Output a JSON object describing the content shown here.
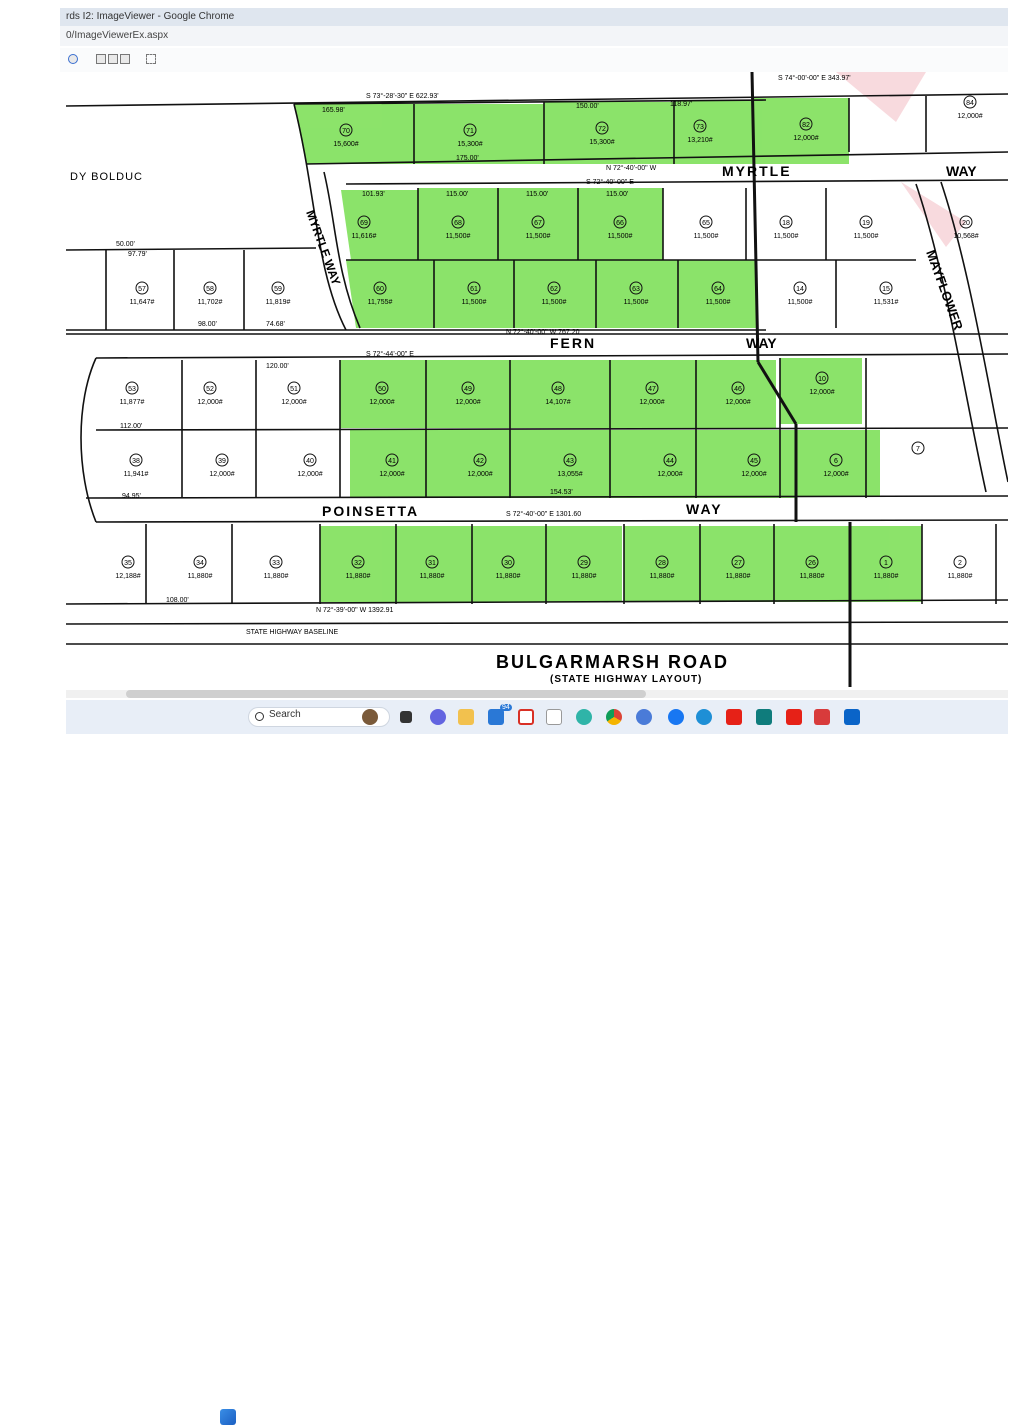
{
  "window": {
    "title": "rds I2: ImageViewer - Google Chrome",
    "address": "0/ImageViewerEx.aspx"
  },
  "map": {
    "neighbor_label": "DY  BOLDUC",
    "streets": [
      {
        "name": "MYRTLE"
      },
      {
        "name": "WAY"
      },
      {
        "name": "FERN"
      },
      {
        "name": "POINSETTA"
      },
      {
        "name": "WAY"
      },
      {
        "name": "WAY"
      },
      {
        "name": "BULGARMARSH   ROAD"
      },
      {
        "name": "(STATE  HIGHWAY  LAYOUT)"
      },
      {
        "name": "MAYFLOWER"
      },
      {
        "name": "MYRTLE  WAY"
      },
      {
        "name": "STATE HIGHWAY BASELINE"
      }
    ],
    "lots": [
      {
        "id": "70",
        "area": "15,600",
        "highlight": true
      },
      {
        "id": "71",
        "area": "15,300",
        "highlight": true
      },
      {
        "id": "72",
        "area": "15,300",
        "highlight": true
      },
      {
        "id": "73",
        "area": "13,210",
        "highlight": true
      },
      {
        "id": "82",
        "area": "12,000",
        "highlight": true
      },
      {
        "id": "84",
        "area": "12,000",
        "highlight": false
      },
      {
        "id": "69",
        "area": "11,616",
        "highlight": true
      },
      {
        "id": "68",
        "area": "11,500",
        "highlight": true
      },
      {
        "id": "67",
        "area": "11,500",
        "highlight": true
      },
      {
        "id": "66",
        "area": "11,500",
        "highlight": true
      },
      {
        "id": "65",
        "area": "11,500",
        "highlight": false
      },
      {
        "id": "18",
        "area": "11,500",
        "highlight": false
      },
      {
        "id": "19",
        "area": "11,500",
        "highlight": false
      },
      {
        "id": "20",
        "area": "10,568",
        "highlight": false
      },
      {
        "id": "60",
        "area": "11,755",
        "highlight": true
      },
      {
        "id": "61",
        "area": "11,500",
        "highlight": true
      },
      {
        "id": "62",
        "area": "11,500",
        "highlight": true
      },
      {
        "id": "63",
        "area": "11,500",
        "highlight": true
      },
      {
        "id": "64",
        "area": "11,500",
        "highlight": true
      },
      {
        "id": "14",
        "area": "11,500",
        "highlight": false
      },
      {
        "id": "15",
        "area": "11,531",
        "highlight": false
      },
      {
        "id": "57",
        "area": "11,647",
        "highlight": false
      },
      {
        "id": "58",
        "area": "11,702",
        "highlight": false
      },
      {
        "id": "59",
        "area": "11,819",
        "highlight": false
      },
      {
        "id": "53",
        "area": "11,877",
        "highlight": false
      },
      {
        "id": "52",
        "area": "12,000",
        "highlight": false
      },
      {
        "id": "51",
        "area": "12,000",
        "highlight": false
      },
      {
        "id": "50",
        "area": "12,000",
        "highlight": true
      },
      {
        "id": "49",
        "area": "12,000",
        "highlight": true
      },
      {
        "id": "48",
        "area": "14,107",
        "highlight": true
      },
      {
        "id": "47",
        "area": "12,000",
        "highlight": true
      },
      {
        "id": "46",
        "area": "12,000",
        "highlight": true
      },
      {
        "id": "10",
        "area": "12,000",
        "highlight": true
      },
      {
        "id": "38",
        "area": "11,941",
        "highlight": false
      },
      {
        "id": "39",
        "area": "12,000",
        "highlight": false
      },
      {
        "id": "40",
        "area": "12,000",
        "highlight": false
      },
      {
        "id": "41",
        "area": "12,000",
        "highlight": true
      },
      {
        "id": "42",
        "area": "12,000",
        "highlight": true
      },
      {
        "id": "43",
        "area": "13,055",
        "highlight": true
      },
      {
        "id": "44",
        "area": "12,000",
        "highlight": true
      },
      {
        "id": "45",
        "area": "12,000",
        "highlight": true
      },
      {
        "id": "6",
        "area": "12,000",
        "highlight": true
      },
      {
        "id": "7",
        "area": "",
        "highlight": false
      },
      {
        "id": "35",
        "area": "12,188",
        "highlight": false
      },
      {
        "id": "34",
        "area": "11,880",
        "highlight": false
      },
      {
        "id": "33",
        "area": "11,880",
        "highlight": false
      },
      {
        "id": "32",
        "area": "11,880",
        "highlight": true
      },
      {
        "id": "31",
        "area": "11,880",
        "highlight": true
      },
      {
        "id": "30",
        "area": "11,880",
        "highlight": true
      },
      {
        "id": "29",
        "area": "11,880",
        "highlight": true
      },
      {
        "id": "28",
        "area": "11,880",
        "highlight": true
      },
      {
        "id": "27",
        "area": "11,880",
        "highlight": true
      },
      {
        "id": "26",
        "area": "11,880",
        "highlight": true
      },
      {
        "id": "1",
        "area": "11,880",
        "highlight": true
      },
      {
        "id": "2",
        "area": "11,880",
        "highlight": false
      }
    ],
    "dims": [
      "S 73°-28'-30\" E  622.93'",
      "165.98'",
      "175.00'",
      "150.00'",
      "118.97'",
      "101.93'",
      "115.00'",
      "115.00'",
      "115.00'",
      "N 72°-40'-00\" W",
      "S 72°-40'-00\" E",
      "50.00'",
      "97.79'",
      "98.00'",
      "74.68'",
      "N 72°-40'-00\" W  767.20",
      "S 72°-44'-00\" E",
      "120.00'",
      "S 72°-40'-00\" E  1301.60",
      "N 72°-39'-00\" W  1392.91",
      "112.00'",
      "94.95'",
      "154.53'",
      "108.00'",
      "S 74°-00'-00\" E  343.97'"
    ],
    "colors": {
      "highlight": "#7fe05a",
      "line": "#111111",
      "paper": "#ffffff"
    }
  },
  "taskbar": {
    "search_placeholder": "Search",
    "icons": [
      "windows-start-icon",
      "search-icon",
      "widget-icon",
      "task-view-icon",
      "chat-icon",
      "file-explorer-icon",
      "mail-icon",
      "gmail-icon",
      "amazon-icon",
      "edge-icon",
      "chrome-icon",
      "photos-icon",
      "facebook-icon",
      "edge-dev-icon",
      "youtube-icon",
      "sway-icon",
      "youtube2-icon",
      "news-icon",
      "outlook-icon"
    ],
    "mail_badge": "94"
  }
}
